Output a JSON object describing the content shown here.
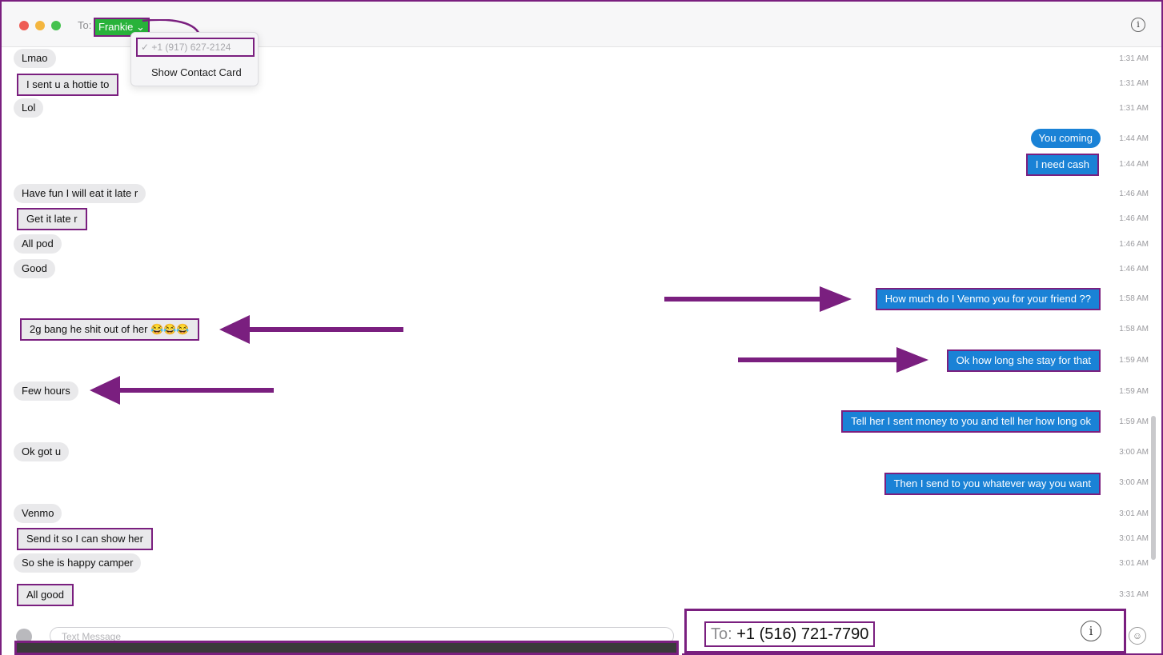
{
  "header": {
    "to_label": "To:",
    "recipient": "Frankie",
    "chevron": "chevron-down-icon",
    "info": "info-icon"
  },
  "dropdown": {
    "phone": "✓ +1 (917) 627-2124",
    "show_contact": "Show Contact Card"
  },
  "messages": [
    {
      "text": "Lmao",
      "time": "1:31 AM"
    },
    {
      "text": "I sent u a hottie to",
      "time": "1:31 AM"
    },
    {
      "text": "Lol",
      "time": "1:31 AM"
    },
    {
      "text": "You coming",
      "time": "1:44 AM"
    },
    {
      "text": "I need cash",
      "time": "1:44 AM"
    },
    {
      "text": "Have fun I will eat it late r",
      "time": "1:46 AM"
    },
    {
      "text": "Get it late r",
      "time": "1:46 AM"
    },
    {
      "text": "All pod",
      "time": "1:46 AM"
    },
    {
      "text": "Good",
      "time": "1:46 AM"
    },
    {
      "text": "How much do I Venmo you for your friend ??",
      "time": "1:58 AM"
    },
    {
      "text": "2g bang he shit out of her 😂😂😂",
      "time": "1:58 AM"
    },
    {
      "text": "Ok how long she stay for that",
      "time": "1:59 AM"
    },
    {
      "text": "Few hours",
      "time": "1:59 AM"
    },
    {
      "text": "Tell her I sent money to you and tell her how long ok",
      "time": "1:59 AM"
    },
    {
      "text": "Ok got u",
      "time": "3:00 AM"
    },
    {
      "text": "Then I send to you whatever way you want",
      "time": "3:00 AM"
    },
    {
      "text": "Venmo",
      "time": "3:01 AM"
    },
    {
      "text": "Send it so I can show her",
      "time": "3:01 AM"
    },
    {
      "text": "So she is happy camper",
      "time": "3:01 AM"
    },
    {
      "text": "All good",
      "time": "3:31 AM"
    }
  ],
  "composer": {
    "placeholder": "Text Message",
    "camera": "camera-icon",
    "emoji": "emoji-icon"
  },
  "inset": {
    "to_label": "To:",
    "phone": "+1 (516) 721-7790",
    "info": "info-icon"
  },
  "colors": {
    "highlight": "#7a1f7f",
    "outgoing": "#1a82d6",
    "incoming": "#e9e9eb",
    "chip": "#28b23a"
  }
}
